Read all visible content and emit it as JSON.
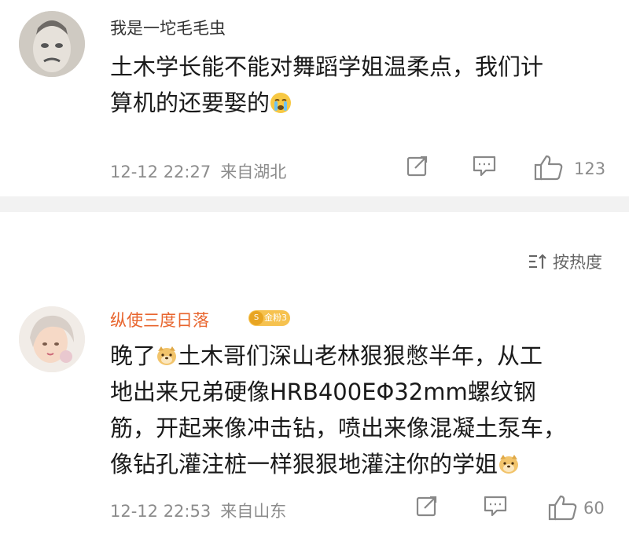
{
  "comment1": {
    "username": "我是一坨毛毛虫",
    "text_line1": "土木学长能不能对舞蹈学姐温柔点，我们计",
    "text_line2": "算机的还要娶的",
    "emoji": "crying-face",
    "time": "12-12 22:27",
    "location": "来自湖北",
    "likes": "123"
  },
  "sort_label": "按热度",
  "comment2": {
    "username": "纵使三度日落",
    "badge": "金粉3",
    "text_line1_a": "晚了",
    "text_line1_b": "土木哥们深山老林狠狠憋半年，从工",
    "text_line2": "地出来兄弟硬像HRB400EΦ32mm螺纹钢",
    "text_line3": "筋，开起来像冲击钻，喷出来像混凝土泵车，",
    "text_line4": "像钻孔灌注桩一样狠狠地灌注你的学姐",
    "emoji": "doge",
    "time": "12-12 22:53",
    "location": "来自山东",
    "likes": "60"
  },
  "colors": {
    "username_fan": "#e8652e",
    "meta": "#8c8c8c",
    "divider": "#f2f2f2",
    "badge": "#f6c24f"
  },
  "icons": [
    "share-icon",
    "reply-icon",
    "like-icon",
    "sort-icon"
  ]
}
